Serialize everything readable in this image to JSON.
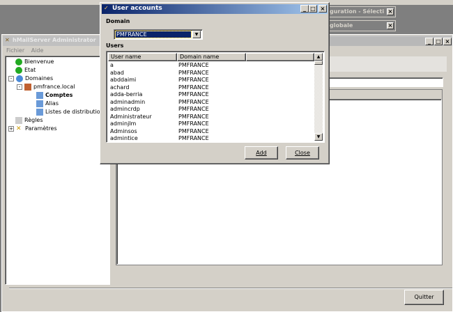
{
  "bg_windows": [
    {
      "title": "guration - Sélecti"
    },
    {
      "title": "globale"
    }
  ],
  "main": {
    "title": "hMailServer Administrator",
    "menu": [
      "Fichier",
      "Aide"
    ],
    "tree": [
      {
        "label": "Bienvenue"
      },
      {
        "label": "Etat"
      },
      {
        "label": "Domaines"
      },
      {
        "label": "pmfrance.local"
      },
      {
        "label": "Comptes"
      },
      {
        "label": "Alias"
      },
      {
        "label": "Listes de distribution"
      },
      {
        "label": "Règles"
      },
      {
        "label": "Paramètres"
      }
    ],
    "quit_label": "Quitter"
  },
  "dialog": {
    "title": "User accounts",
    "domain_label": "Domain",
    "domain_value": "PMFRANCE",
    "users_label": "Users",
    "columns": [
      "User name",
      "Domain name"
    ],
    "rows": [
      [
        "a",
        "PMFRANCE"
      ],
      [
        "abad",
        "PMFRANCE"
      ],
      [
        "abddaimi",
        "PMFRANCE"
      ],
      [
        "achard",
        "PMFRANCE"
      ],
      [
        "adda-berria",
        "PMFRANCE"
      ],
      [
        "adminadmin",
        "PMFRANCE"
      ],
      [
        "admincrdp",
        "PMFRANCE"
      ],
      [
        "Administrateur",
        "PMFRANCE"
      ],
      [
        "adminjlm",
        "PMFRANCE"
      ],
      [
        "Adminsos",
        "PMFRANCE"
      ],
      [
        "admintice",
        "PMFRANCE"
      ]
    ],
    "add_label": "Add",
    "close_label": "Close"
  },
  "colors": {
    "dialog_title": "#0a246a",
    "selection": "#0a246a",
    "face": "#d4d0c8"
  }
}
